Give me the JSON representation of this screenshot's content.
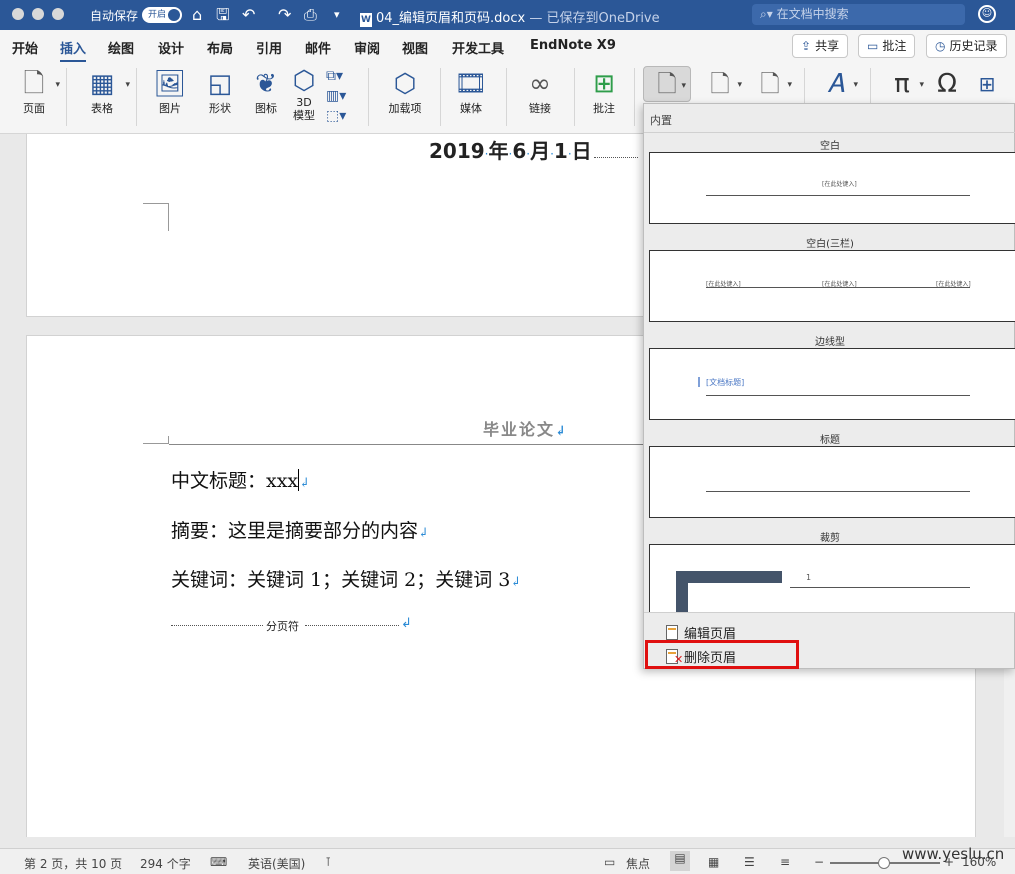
{
  "titlebar": {
    "autosave_label": "自动保存",
    "autosave_toggle": "开启",
    "doc_name": "04_编辑页眉和页码.docx",
    "saved_status": " — 已保存到OneDrive",
    "search_placeholder": "在文档中搜索",
    "icons": [
      "home-icon",
      "save-icon",
      "undo-icon",
      "redo-icon",
      "print-icon",
      "customize-icon",
      "smiley-icon"
    ]
  },
  "tabs": {
    "items": [
      "开始",
      "插入",
      "绘图",
      "设计",
      "布局",
      "引用",
      "邮件",
      "审阅",
      "视图",
      "开发工具",
      "EndNote X9"
    ],
    "active": "插入",
    "share": "共享",
    "comments": "批注",
    "history": "历史记录"
  },
  "ribbon": {
    "page": "页面",
    "table": "表格",
    "picture": "图片",
    "shapes": "形状",
    "icons": "图标",
    "model3d_line1": "3D",
    "model3d_line2": "模型",
    "addins": "加载项",
    "media": "媒体",
    "link": "链接",
    "comment": "批注"
  },
  "document": {
    "date_parts": [
      "2019",
      "年",
      "6",
      "月",
      "1",
      "日"
    ],
    "header_title": "毕业论文",
    "lines": [
      {
        "text": "中文标题：xxx"
      },
      {
        "text": "摘要：这里是摘要部分的内容"
      },
      {
        "text": "关键词：关键词 1；关键词 2；关键词 3"
      }
    ],
    "page_break": "分页符",
    "pilcrow": "↲"
  },
  "gallery": {
    "section_title": "内置",
    "templates": [
      {
        "name": "空白",
        "placeholder": "[在此处键入]"
      },
      {
        "name": "空白(三栏)",
        "placeholder": "[在此处键入]"
      },
      {
        "name": "边线型",
        "placeholder": "[文档标题]"
      },
      {
        "name": "标题",
        "placeholder": ""
      },
      {
        "name": "裁剪",
        "placeholder": "1"
      }
    ],
    "edit_header": "编辑页眉",
    "remove_header": "删除页眉"
  },
  "statusbar": {
    "page_info": "第 2 页，共 10 页",
    "word_count": "294 个字",
    "language": "英语(美国)",
    "focus": "焦点",
    "zoom": "160%"
  },
  "watermark": "www.yeslu.cn",
  "colors": {
    "accent": "#2b5797",
    "highlight": "#e01010"
  }
}
